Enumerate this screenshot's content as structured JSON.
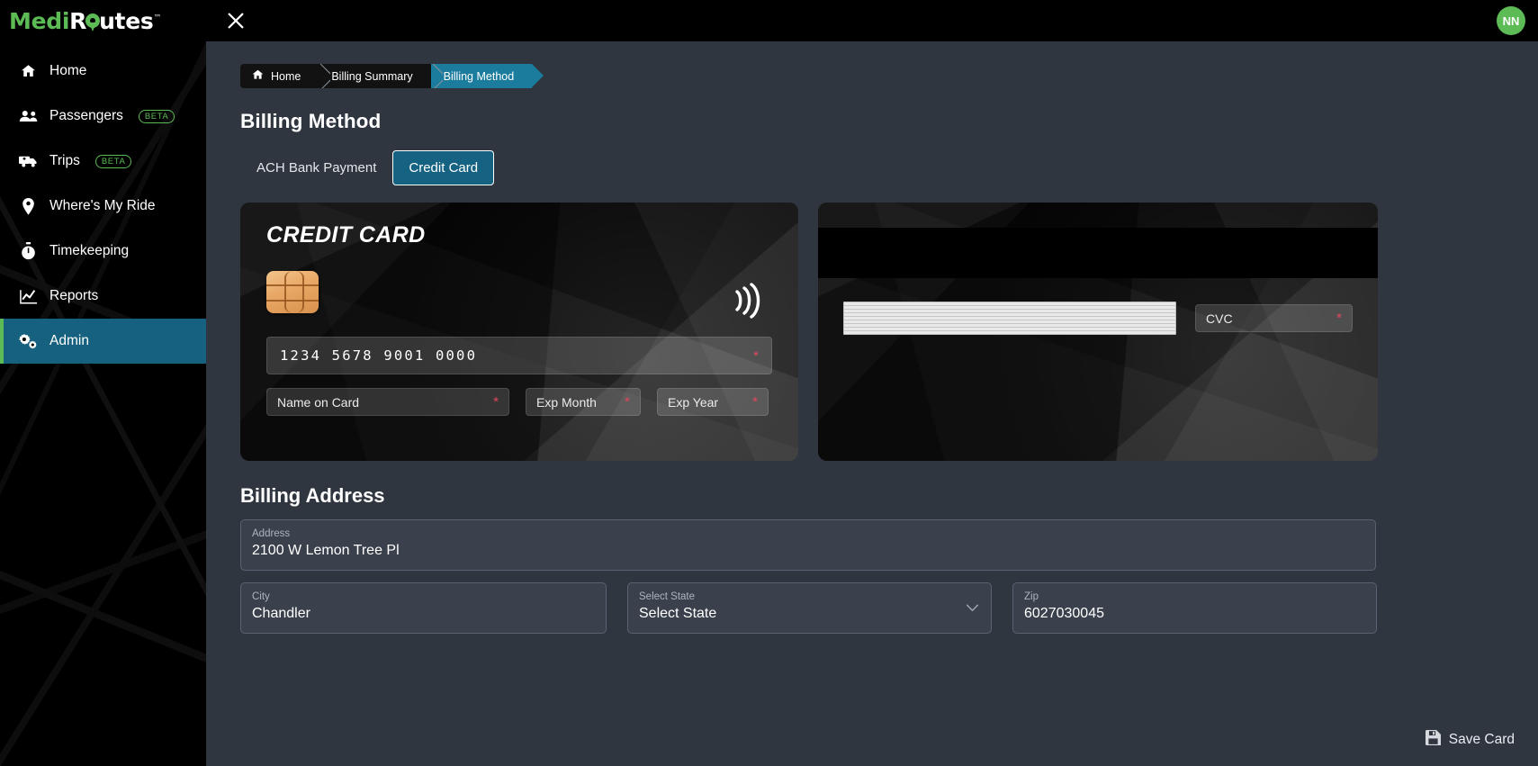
{
  "app": {
    "brand_prefix": "Medi",
    "brand_suffix": "utes",
    "brand_mid": "R",
    "brand_tm": "™",
    "accent_green": "#5cbb54",
    "accent_teal": "#16617f",
    "required_red": "#e0475b"
  },
  "sidebar": {
    "items": [
      {
        "label": "Home",
        "icon": "home-icon",
        "badge": null,
        "active": false
      },
      {
        "label": "Passengers",
        "icon": "users-icon",
        "badge": "BETA",
        "active": false
      },
      {
        "label": "Trips",
        "icon": "ambulance-icon",
        "badge": "BETA",
        "active": false
      },
      {
        "label": "Where's My Ride",
        "icon": "map-pin-icon",
        "badge": null,
        "active": false
      },
      {
        "label": "Timekeeping",
        "icon": "stopwatch-icon",
        "badge": null,
        "active": false
      },
      {
        "label": "Reports",
        "icon": "chart-line-icon",
        "badge": null,
        "active": false
      },
      {
        "label": "Admin",
        "icon": "gears-icon",
        "badge": null,
        "active": true
      }
    ]
  },
  "topbar": {
    "close_icon": "close-icon",
    "avatar_initials": "NN"
  },
  "breadcrumb": {
    "items": [
      {
        "label": "Home",
        "icon": "home-icon",
        "active": false
      },
      {
        "label": "Billing Summary",
        "icon": null,
        "active": false
      },
      {
        "label": "Billing Method",
        "icon": null,
        "active": true
      }
    ]
  },
  "page": {
    "title": "Billing Method"
  },
  "tabs": [
    {
      "label": "ACH Bank Payment",
      "active": false
    },
    {
      "label": "Credit Card",
      "active": true
    }
  ],
  "card_front": {
    "title": "CREDIT CARD",
    "chip_icon": "emv-chip-icon",
    "contactless_icon": "contactless-icon",
    "number_placeholder": "1234 5678 9001 0000",
    "number_required": "*",
    "name_placeholder": "Name on Card",
    "name_required": "*",
    "exp_month_placeholder": "Exp Month",
    "exp_month_required": "*",
    "exp_year_placeholder": "Exp Year",
    "exp_year_required": "*"
  },
  "card_back": {
    "cvc_placeholder": "CVC",
    "cvc_required": "*",
    "magnetic_stripe": "magnetic-stripe",
    "signature_strip": "signature-strip"
  },
  "billing_address": {
    "section_title": "Billing Address",
    "address": {
      "label": "Address",
      "value": "2100 W Lemon Tree Pl"
    },
    "city": {
      "label": "City",
      "value": "Chandler"
    },
    "state": {
      "label": "Select State",
      "value": "Select State"
    },
    "zip": {
      "label": "Zip",
      "value": "6027030045"
    }
  },
  "footer": {
    "save_label": "Save Card",
    "save_icon": "save-icon"
  }
}
